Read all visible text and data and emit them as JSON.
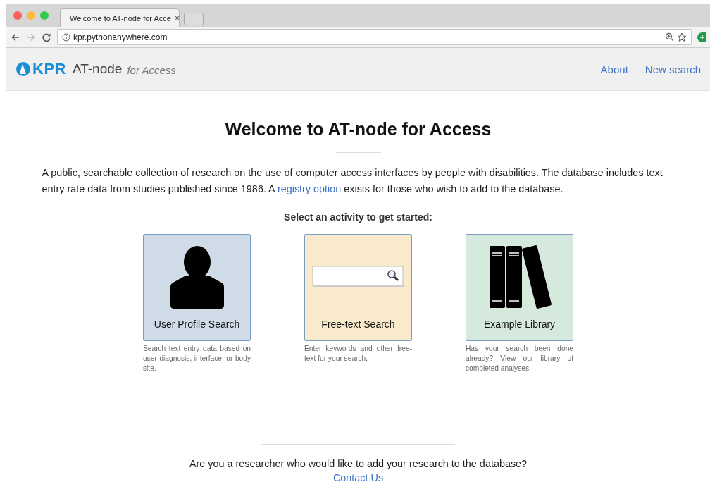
{
  "browser": {
    "tab_title": "Welcome to AT-node for Acce",
    "tab_close": "×",
    "url": "kpr.pythonanywhere.com"
  },
  "header": {
    "logo_text": "KPR",
    "product": "AT-node",
    "product_suffix": "for Access",
    "nav": [
      "About",
      "New search"
    ]
  },
  "main": {
    "title": "Welcome to AT-node for Access",
    "intro_before": "A public, searchable collection of research on the use of computer access interfaces by people with disabilities. The database includes text entry rate data from studies published since 1986. A ",
    "intro_link": "registry option",
    "intro_after": " exists for those who wish to add to the database.",
    "prompt": "Select an activity to get started:",
    "cards": [
      {
        "kind": "person",
        "label": "User Profile Search",
        "color": "#cfdce8",
        "description": "Search text entry data based on user diagnosis, interface, or body site."
      },
      {
        "kind": "search",
        "label": "Free-text Search",
        "color": "#faeacc",
        "description": "Enter keywords and other free-text for your search."
      },
      {
        "kind": "books",
        "label": "Example Library",
        "color": "#d6e9dd",
        "description": "Has your search been done already? View our library of completed analyses."
      }
    ]
  },
  "footer": {
    "question": "Are you a researcher who would like to add your research to the database?",
    "link": "Contact Us"
  }
}
